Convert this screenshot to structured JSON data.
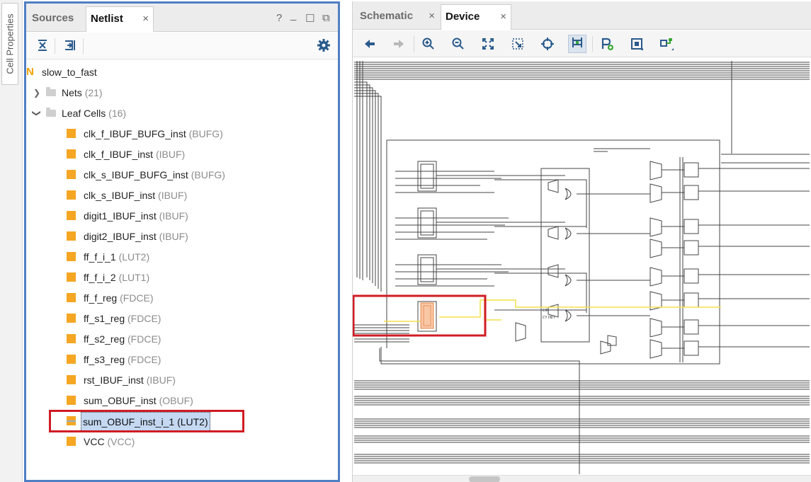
{
  "side_strip": {
    "tab_label": "Cell Properties"
  },
  "left_panel": {
    "tabs": [
      {
        "label": "Sources",
        "active": false
      },
      {
        "label": "Netlist",
        "active": true,
        "close": "×"
      }
    ],
    "window_controls": {
      "help": "?",
      "minimize": "_",
      "restore": "☐",
      "float": "⧉"
    },
    "toolbar": {
      "collapse_icon": "collapse-all-icon",
      "expand_icon": "expand-all-icon",
      "settings_icon": "gear-icon"
    },
    "tree": {
      "root": {
        "badge": "N",
        "label": "slow_to_fast"
      },
      "nets": {
        "label": "Nets",
        "count": "(21)",
        "expanded": false
      },
      "leaf_cells": {
        "label": "Leaf Cells",
        "count": "(16)",
        "expanded": true
      },
      "cells": [
        {
          "name": "clk_f_IBUF_BUFG_inst",
          "type": "(BUFG)"
        },
        {
          "name": "clk_f_IBUF_inst",
          "type": "(IBUF)"
        },
        {
          "name": "clk_s_IBUF_BUFG_inst",
          "type": "(BUFG)"
        },
        {
          "name": "clk_s_IBUF_inst",
          "type": "(IBUF)"
        },
        {
          "name": "digit1_IBUF_inst",
          "type": "(IBUF)"
        },
        {
          "name": "digit2_IBUF_inst",
          "type": "(IBUF)"
        },
        {
          "name": "ff_f_i_1",
          "type": "(LUT2)"
        },
        {
          "name": "ff_f_i_2",
          "type": "(LUT1)"
        },
        {
          "name": "ff_f_reg",
          "type": "(FDCE)"
        },
        {
          "name": "ff_s1_reg",
          "type": "(FDCE)"
        },
        {
          "name": "ff_s2_reg",
          "type": "(FDCE)"
        },
        {
          "name": "ff_s3_reg",
          "type": "(FDCE)"
        },
        {
          "name": "rst_IBUF_inst",
          "type": "(IBUF)"
        },
        {
          "name": "sum_OBUF_inst",
          "type": "(OBUF)"
        },
        {
          "name": "sum_OBUF_inst_i_1",
          "type": "(LUT2)",
          "selected": true
        },
        {
          "name": "VCC",
          "type": "(VCC)"
        }
      ]
    }
  },
  "right_panel": {
    "tabs": [
      {
        "label": "Schematic",
        "active": false,
        "close": "×"
      },
      {
        "label": "Device",
        "active": true,
        "close": "×"
      }
    ],
    "toolbar": [
      "back-icon",
      "forward-icon",
      "zoom-in-icon",
      "zoom-out-icon",
      "zoom-fit-icon",
      "zoom-area-icon",
      "select-center-icon",
      "routing-resources-icon",
      "add-pblock-icon",
      "draw-pblock-icon",
      "route-icon"
    ],
    "device_view": {
      "small_labels": [
        "CIN",
        "CY INIT"
      ]
    }
  },
  "colors": {
    "panel_border": "#4f7fc4",
    "highlight_red": "#d01c24",
    "cell_icon": "#f5a623",
    "selected_net": "#f3e14a",
    "selected_cell": "#f8c7a6"
  }
}
